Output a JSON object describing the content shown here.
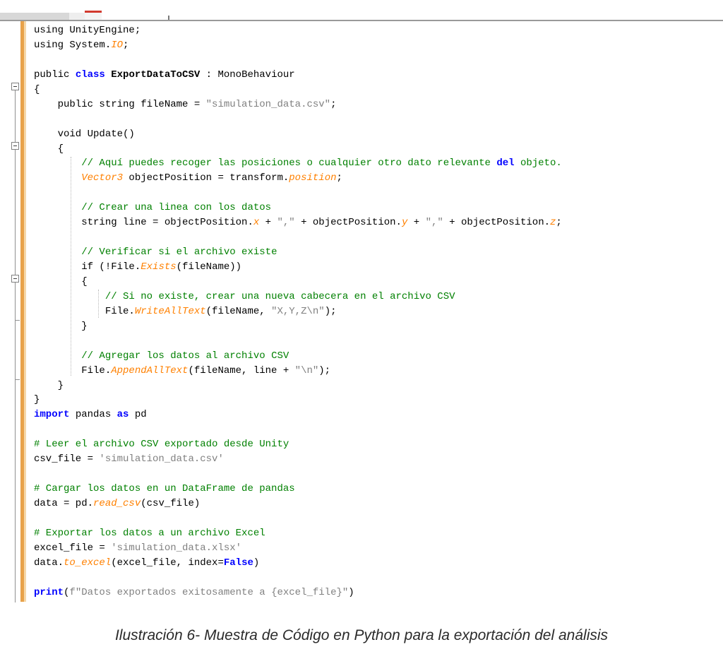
{
  "code": {
    "lines": [
      [
        {
          "t": "using UnityEngine;"
        }
      ],
      [
        {
          "t": "using System."
        },
        {
          "t": "IO",
          "c": "it"
        },
        {
          "t": ";"
        }
      ],
      [
        {
          "t": ""
        }
      ],
      [
        {
          "t": "public "
        },
        {
          "t": "class",
          "c": "kw"
        },
        {
          "t": " "
        },
        {
          "t": "ExportDataToCSV",
          "c": "bold"
        },
        {
          "t": " : MonoBehaviour"
        }
      ],
      [
        {
          "t": "{"
        }
      ],
      [
        {
          "t": "    public string fileName = "
        },
        {
          "t": "\"simulation_data.csv\"",
          "c": "str"
        },
        {
          "t": ";"
        }
      ],
      [
        {
          "t": ""
        }
      ],
      [
        {
          "t": "    void Update()"
        }
      ],
      [
        {
          "t": "    {"
        }
      ],
      [
        {
          "t": "        "
        },
        {
          "t": "// Aquí puedes recoger las posiciones o cualquier otro dato relevante ",
          "c": "cm"
        },
        {
          "t": "del",
          "c": "kw"
        },
        {
          "t": " objeto.",
          "c": "cm"
        }
      ],
      [
        {
          "t": "        "
        },
        {
          "t": "Vector3",
          "c": "it"
        },
        {
          "t": " objectPosition = transform."
        },
        {
          "t": "position",
          "c": "it"
        },
        {
          "t": ";"
        }
      ],
      [
        {
          "t": ""
        }
      ],
      [
        {
          "t": "        "
        },
        {
          "t": "// Crear una linea con los datos",
          "c": "cm"
        }
      ],
      [
        {
          "t": "        string line = objectPosition."
        },
        {
          "t": "x",
          "c": "it"
        },
        {
          "t": " + "
        },
        {
          "t": "\",\"",
          "c": "str"
        },
        {
          "t": " + objectPosition."
        },
        {
          "t": "y",
          "c": "it"
        },
        {
          "t": " + "
        },
        {
          "t": "\",\"",
          "c": "str"
        },
        {
          "t": " + objectPosition."
        },
        {
          "t": "z",
          "c": "it"
        },
        {
          "t": ";"
        }
      ],
      [
        {
          "t": ""
        }
      ],
      [
        {
          "t": "        "
        },
        {
          "t": "// Verificar si el archivo existe",
          "c": "cm"
        }
      ],
      [
        {
          "t": "        if (!File."
        },
        {
          "t": "Exists",
          "c": "it"
        },
        {
          "t": "(fileName))"
        }
      ],
      [
        {
          "t": "        {"
        }
      ],
      [
        {
          "t": "            "
        },
        {
          "t": "// Si no existe, crear una nueva cabecera en el archivo CSV",
          "c": "cm"
        }
      ],
      [
        {
          "t": "            File."
        },
        {
          "t": "WriteAllText",
          "c": "it"
        },
        {
          "t": "(fileName, "
        },
        {
          "t": "\"X,Y,Z\\n\"",
          "c": "str"
        },
        {
          "t": ");"
        }
      ],
      [
        {
          "t": "        }"
        }
      ],
      [
        {
          "t": ""
        }
      ],
      [
        {
          "t": "        "
        },
        {
          "t": "// Agregar los datos al archivo CSV",
          "c": "cm"
        }
      ],
      [
        {
          "t": "        File."
        },
        {
          "t": "AppendAllText",
          "c": "it"
        },
        {
          "t": "(fileName, line + "
        },
        {
          "t": "\"\\n\"",
          "c": "str"
        },
        {
          "t": ");"
        }
      ],
      [
        {
          "t": "    }"
        }
      ],
      [
        {
          "t": "}"
        }
      ],
      [
        {
          "t": "import",
          "c": "kw"
        },
        {
          "t": " pandas "
        },
        {
          "t": "as",
          "c": "kw"
        },
        {
          "t": " pd"
        }
      ],
      [
        {
          "t": ""
        }
      ],
      [
        {
          "t": "# Leer el archivo CSV exportado desde Unity",
          "c": "cm"
        }
      ],
      [
        {
          "t": "csv_file = "
        },
        {
          "t": "'simulation_data.csv'",
          "c": "str"
        }
      ],
      [
        {
          "t": ""
        }
      ],
      [
        {
          "t": "# Cargar los datos en un DataFrame de pandas",
          "c": "cm"
        }
      ],
      [
        {
          "t": "data = pd."
        },
        {
          "t": "read_csv",
          "c": "it"
        },
        {
          "t": "(csv_file)"
        }
      ],
      [
        {
          "t": ""
        }
      ],
      [
        {
          "t": "# Exportar los datos a un archivo Excel",
          "c": "cm"
        }
      ],
      [
        {
          "t": "excel_file = "
        },
        {
          "t": "'simulation_data.xlsx'",
          "c": "str"
        }
      ],
      [
        {
          "t": "data."
        },
        {
          "t": "to_excel",
          "c": "it"
        },
        {
          "t": "(excel_file, index="
        },
        {
          "t": "False",
          "c": "kw"
        },
        {
          "t": ")"
        }
      ],
      [
        {
          "t": ""
        }
      ],
      [
        {
          "t": "print",
          "c": "kw"
        },
        {
          "t": "("
        },
        {
          "t": "f\"Datos exportados exitosamente a {excel_file}\"",
          "c": "str"
        },
        {
          "t": ")"
        }
      ]
    ]
  },
  "caption": "Ilustración 6- Muestra de Código en Python para la exportación del análisis",
  "colors": {
    "keyword": "#0000ff",
    "comment": "#008000",
    "string": "#808080",
    "identifier_italic": "#ff8000",
    "margin_bar": "#e8a24a",
    "active_tab_accent": "#d23a2e"
  }
}
